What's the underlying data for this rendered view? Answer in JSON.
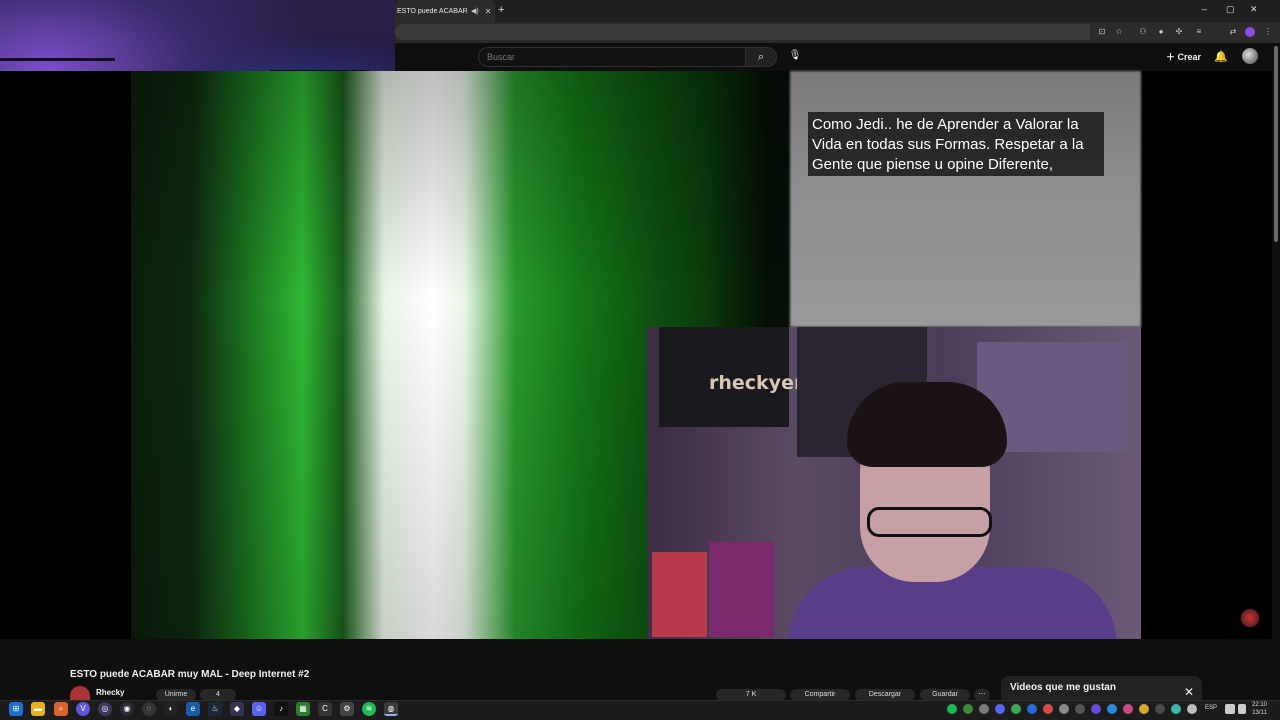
{
  "browser": {
    "tab_title": "ESTO puede ACABAR muy",
    "tab_audio_icon": "speaker-icon",
    "tab_close": "✕",
    "new_tab": "+",
    "window_controls": [
      "‒",
      "▢",
      "✕"
    ]
  },
  "header": {
    "search_placeholder": "Buscar",
    "create_label": "Crear"
  },
  "video": {
    "quote_text": "Como Jedi.. he de Aprender a Valorar la Vida en todas sus Formas. Respetar a la Gente que piense u opine Diferente,",
    "webcam_logo": "rheckyem"
  },
  "below": {
    "video_title": "ESTO puede ACABAR muy MAL - Deep Internet #2",
    "channel_name": "Rhecky",
    "action_pills": [
      "Unirme",
      "4",
      "7 K",
      "Compartir",
      "Descargar",
      "Guardar"
    ]
  },
  "playlist": {
    "title": "Videos que me gustan",
    "close": "✕"
  },
  "taskbar": {
    "language": "ESP",
    "time": "22:10",
    "date": "13/11"
  },
  "colors": {
    "youtube_bg": "#0f0f0f",
    "accent_green": "#2fb834",
    "profile_purple": "#8a4de0"
  }
}
